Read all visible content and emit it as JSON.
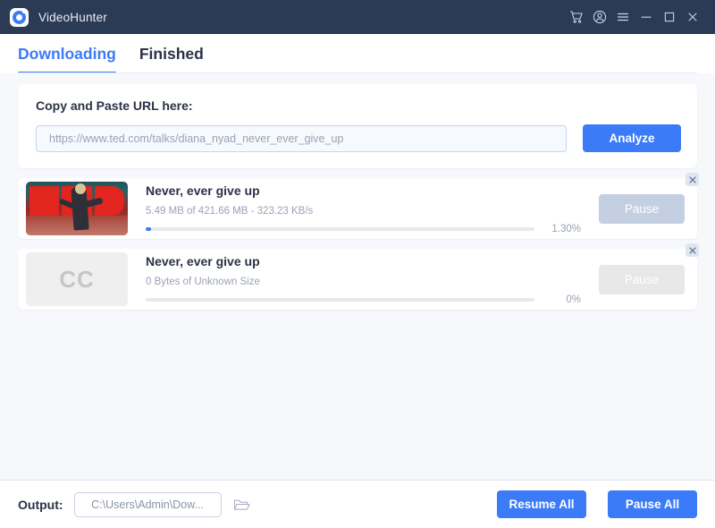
{
  "window": {
    "app_title": "VideoHunter",
    "logo_icon": "videohunter-logo-icon",
    "controls": [
      {
        "name": "cart-icon",
        "label": "Cart"
      },
      {
        "name": "account-icon",
        "label": "Account"
      },
      {
        "name": "menu-icon",
        "label": "Menu"
      },
      {
        "name": "minimize-icon",
        "label": "Minimize"
      },
      {
        "name": "maximize-icon",
        "label": "Maximize"
      },
      {
        "name": "close-icon",
        "label": "Close"
      }
    ]
  },
  "tabs": [
    {
      "label": "Downloading",
      "active": true
    },
    {
      "label": "Finished",
      "active": false
    }
  ],
  "url_panel": {
    "label": "Copy and Paste URL here:",
    "input_value": "",
    "input_placeholder": "https://www.ted.com/talks/diana_nyad_never_ever_give_up",
    "analyze_label": "Analyze"
  },
  "downloads": [
    {
      "thumbnail": "ted-talk-thumbnail",
      "title": "Never, ever give up",
      "status": "5.49 MB of 421.66 MB - 323.23 KB/s",
      "percent_label": "1.30%",
      "percent_value": 1.3,
      "action_label": "Pause",
      "close_label": "✕"
    },
    {
      "thumbnail": "CC",
      "title": "Never, ever give up",
      "status": "0 Bytes of Unknown Size",
      "percent_label": "0%",
      "percent_value": 0,
      "action_label": "Pause",
      "close_label": "✕"
    }
  ],
  "footer": {
    "output_label": "Output:",
    "output_path": "C:\\Users\\Admin\\Dow...",
    "folder_icon": "folder-open-icon",
    "resume_all_label": "Resume All",
    "pause_all_label": "Pause All"
  },
  "colors": {
    "titlebar": "#2b3a55",
    "accent": "#3b7bf7",
    "page_bg": "#f7f8fb",
    "card": "#ffffff",
    "muted_text": "#9aa2b4",
    "pause_disabled_blue": "#c4cfe2",
    "pause_disabled_gray": "#e8e8e8"
  }
}
